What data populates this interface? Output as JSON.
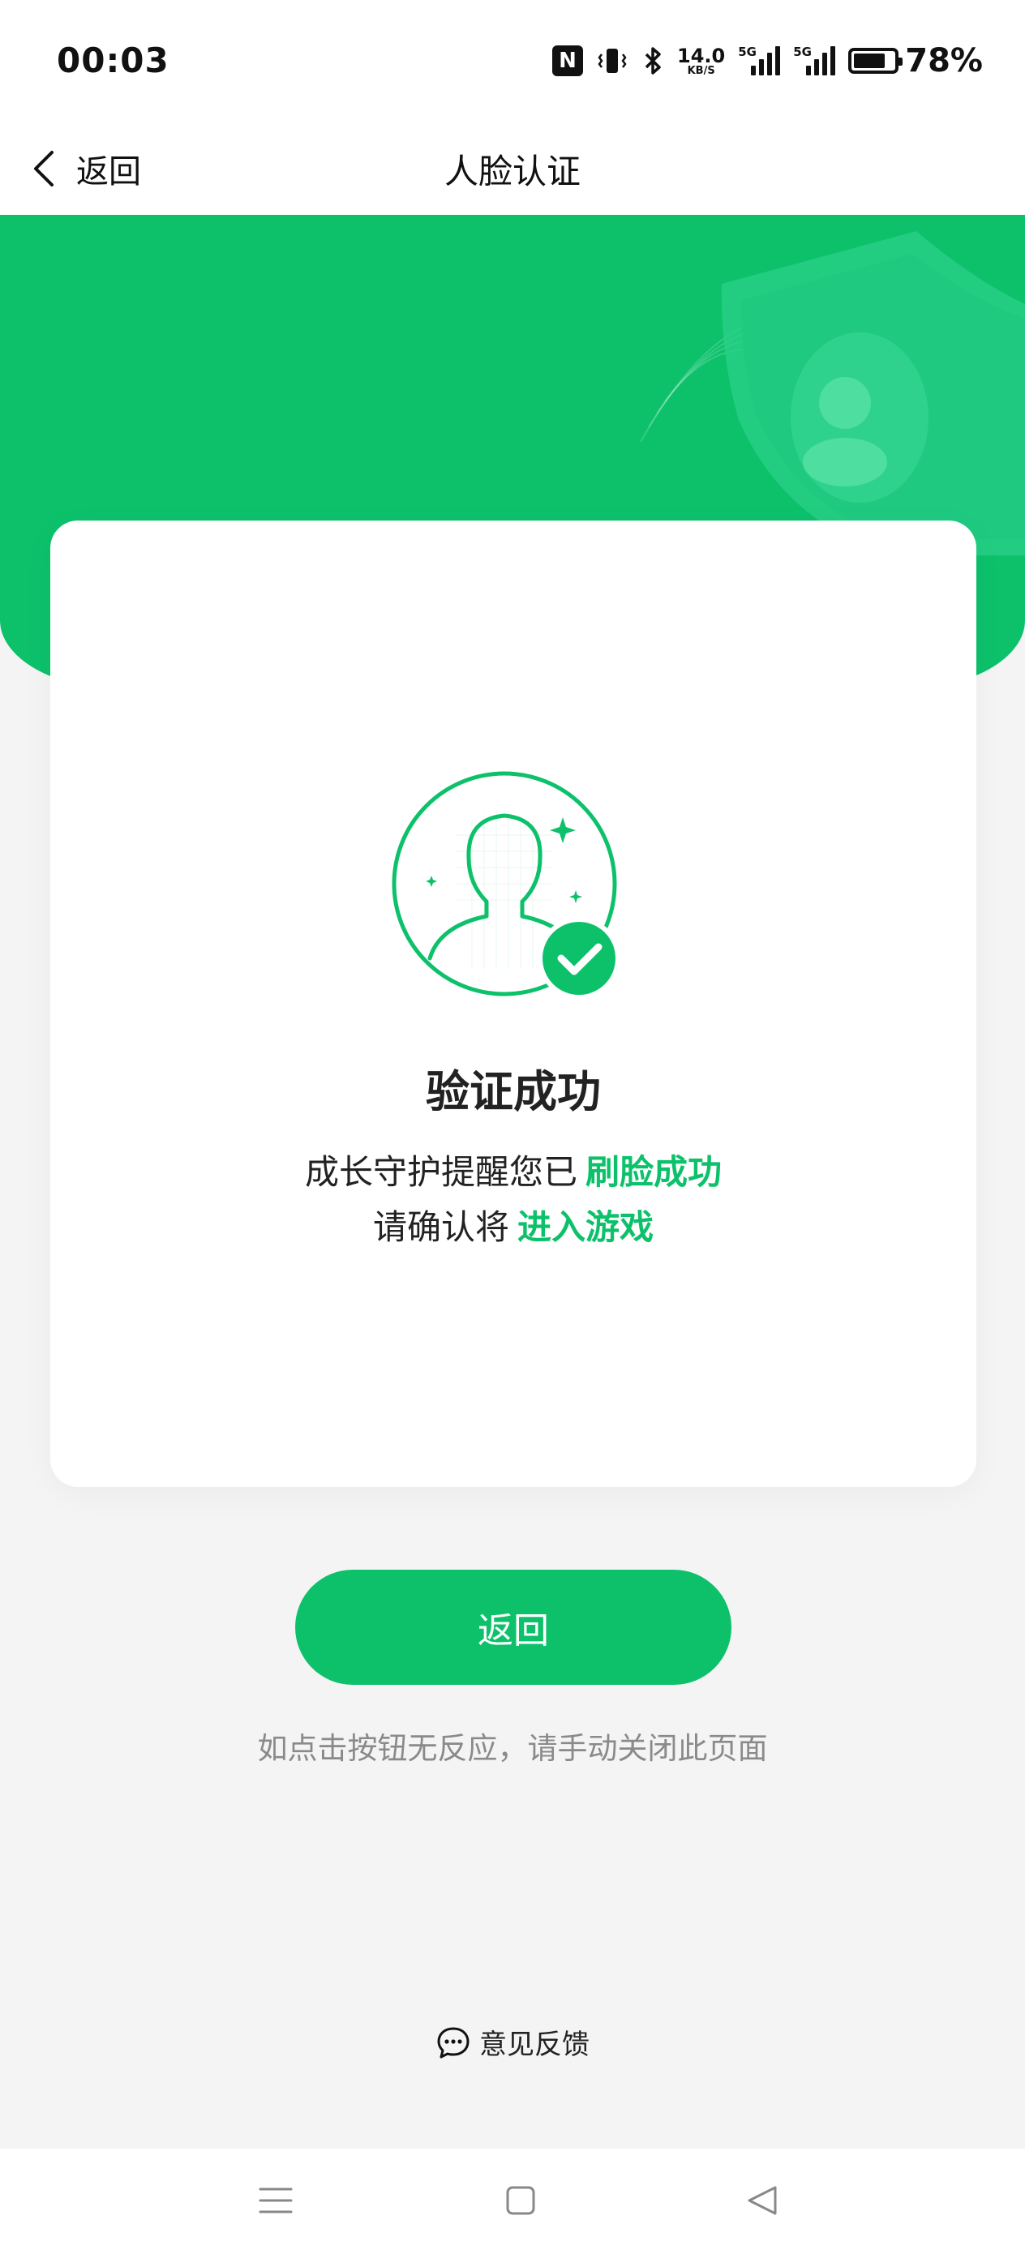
{
  "status_bar": {
    "time": "00:03",
    "nfc_label": "N",
    "net_speed_value": "14.0",
    "net_speed_unit": "KB/S",
    "sim1_tag": "5G",
    "sim2_tag": "5G",
    "battery_level": 0.78,
    "battery_text": "78%"
  },
  "nav": {
    "back_label": "返回",
    "title": "人脸认证"
  },
  "card": {
    "title": "验证成功",
    "line1_prefix": "成长守护提醒您已",
    "line1_highlight": "刷脸成功",
    "line2_prefix": "请确认将",
    "line2_highlight": "进入游戏"
  },
  "actions": {
    "return_button_label": "返回",
    "hint": "如点击按钮无反应，请手动关闭此页面",
    "feedback_label": "意见反馈"
  },
  "colors": {
    "accent": "#0dc16b",
    "background": "#f4f4f4",
    "hint_text": "#8a8a8a"
  },
  "icons": {
    "back": "chevron-left-icon",
    "avatar": "face-verified-icon",
    "feedback": "chat-bubble-icon",
    "sys_menu": "menu-icon",
    "sys_home": "square-home-icon",
    "sys_back": "triangle-back-icon"
  }
}
